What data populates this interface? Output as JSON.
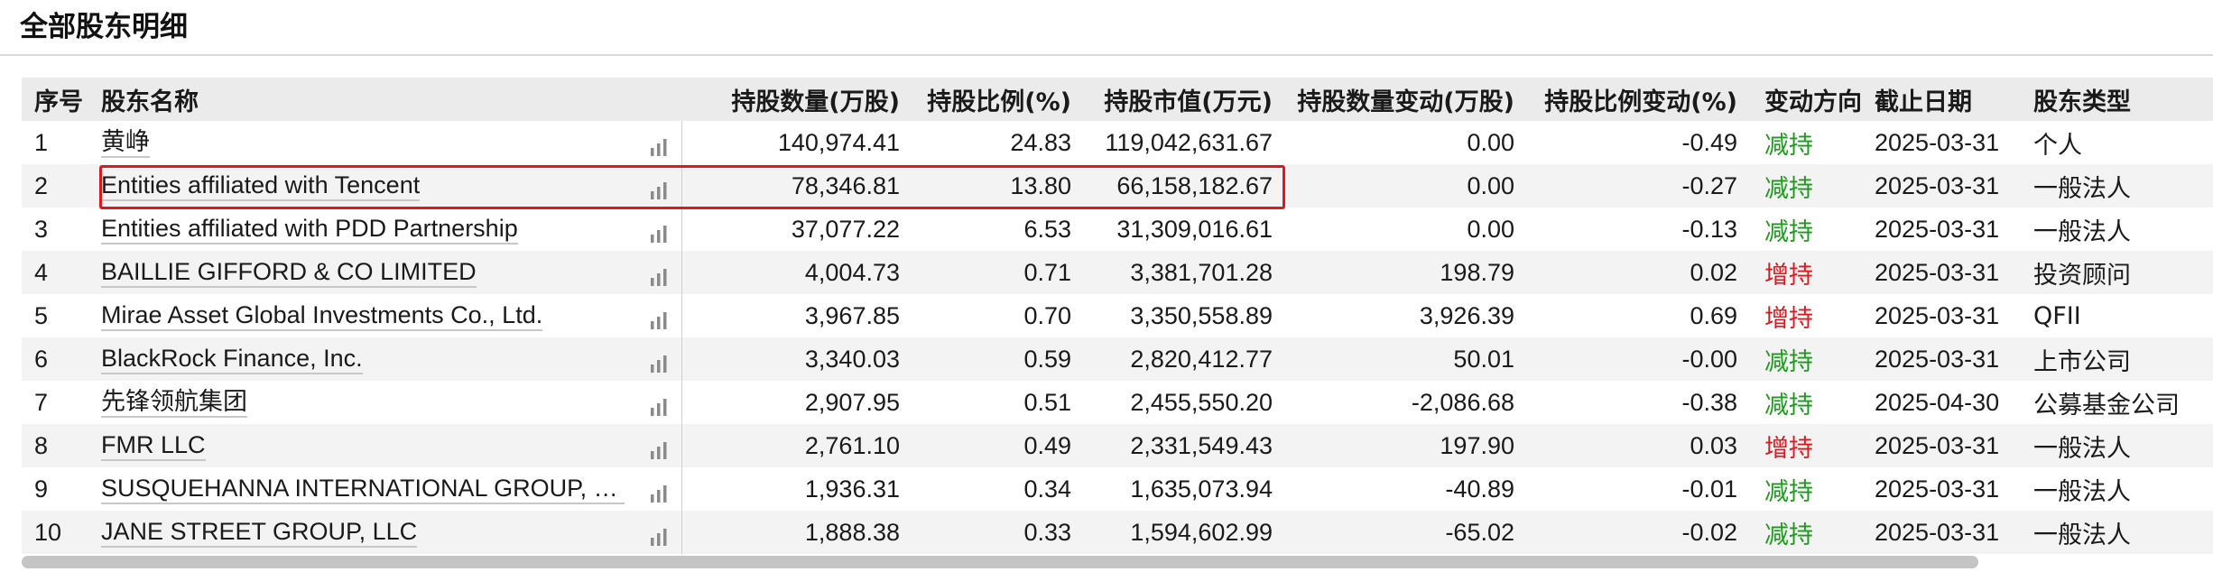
{
  "page": {
    "title": "全部股东明细"
  },
  "table": {
    "headers": {
      "no": "序号",
      "name": "股东名称",
      "qty": "持股数量(万股)",
      "pct": "持股比例(%)",
      "value": "持股市值(万元)",
      "qty_change": "持股数量变动(万股)",
      "pct_change": "持股比例变动(%)",
      "direction": "变动方向",
      "date": "截止日期",
      "type": "股东类型"
    },
    "rows": [
      {
        "no": "1",
        "name": "黄峥",
        "qty": "140,974.41",
        "pct": "24.83",
        "value": "119,042,631.67",
        "qty_change": "0.00",
        "pct_change": "-0.49",
        "direction": "减持",
        "dir_kind": "down",
        "date": "2025-03-31",
        "type": "个人"
      },
      {
        "no": "2",
        "name": "Entities affiliated with Tencent",
        "qty": "78,346.81",
        "pct": "13.80",
        "value": "66,158,182.67",
        "qty_change": "0.00",
        "pct_change": "-0.27",
        "direction": "减持",
        "dir_kind": "down",
        "date": "2025-03-31",
        "type": "一般法人"
      },
      {
        "no": "3",
        "name": "Entities affiliated with PDD Partnership",
        "qty": "37,077.22",
        "pct": "6.53",
        "value": "31,309,016.61",
        "qty_change": "0.00",
        "pct_change": "-0.13",
        "direction": "减持",
        "dir_kind": "down",
        "date": "2025-03-31",
        "type": "一般法人"
      },
      {
        "no": "4",
        "name": "BAILLIE GIFFORD & CO LIMITED",
        "qty": "4,004.73",
        "pct": "0.71",
        "value": "3,381,701.28",
        "qty_change": "198.79",
        "pct_change": "0.02",
        "direction": "增持",
        "dir_kind": "up",
        "date": "2025-03-31",
        "type": "投资顾问"
      },
      {
        "no": "5",
        "name": "Mirae Asset Global Investments Co., Ltd.",
        "qty": "3,967.85",
        "pct": "0.70",
        "value": "3,350,558.89",
        "qty_change": "3,926.39",
        "pct_change": "0.69",
        "direction": "增持",
        "dir_kind": "up",
        "date": "2025-03-31",
        "type": "QFII"
      },
      {
        "no": "6",
        "name": "BlackRock Finance, Inc.",
        "qty": "3,340.03",
        "pct": "0.59",
        "value": "2,820,412.77",
        "qty_change": "50.01",
        "pct_change": "-0.00",
        "direction": "减持",
        "dir_kind": "down",
        "date": "2025-03-31",
        "type": "上市公司"
      },
      {
        "no": "7",
        "name": "先锋领航集团",
        "qty": "2,907.95",
        "pct": "0.51",
        "value": "2,455,550.20",
        "qty_change": "-2,086.68",
        "pct_change": "-0.38",
        "direction": "减持",
        "dir_kind": "down",
        "date": "2025-04-30",
        "type": "公募基金公司"
      },
      {
        "no": "8",
        "name": "FMR LLC",
        "qty": "2,761.10",
        "pct": "0.49",
        "value": "2,331,549.43",
        "qty_change": "197.90",
        "pct_change": "0.03",
        "direction": "增持",
        "dir_kind": "up",
        "date": "2025-03-31",
        "type": "一般法人"
      },
      {
        "no": "9",
        "name": "SUSQUEHANNA INTERNATIONAL GROUP, LLP",
        "qty": "1,936.31",
        "pct": "0.34",
        "value": "1,635,073.94",
        "qty_change": "-40.89",
        "pct_change": "-0.01",
        "direction": "减持",
        "dir_kind": "down",
        "date": "2025-03-31",
        "type": "一般法人"
      },
      {
        "no": "10",
        "name": "JANE STREET GROUP, LLC",
        "qty": "1,888.38",
        "pct": "0.33",
        "value": "1,594,602.99",
        "qty_change": "-65.02",
        "pct_change": "-0.02",
        "direction": "减持",
        "dir_kind": "down",
        "date": "2025-03-31",
        "type": "一般法人"
      }
    ]
  },
  "icons": {
    "row_chart": "bar-chart-icon"
  },
  "colors": {
    "increase": "#e0181e",
    "decrease": "#1e9a1e",
    "highlight": "#e0181e",
    "header_bg": "#ebebeb",
    "stripe_bg": "#f3f3f3"
  }
}
